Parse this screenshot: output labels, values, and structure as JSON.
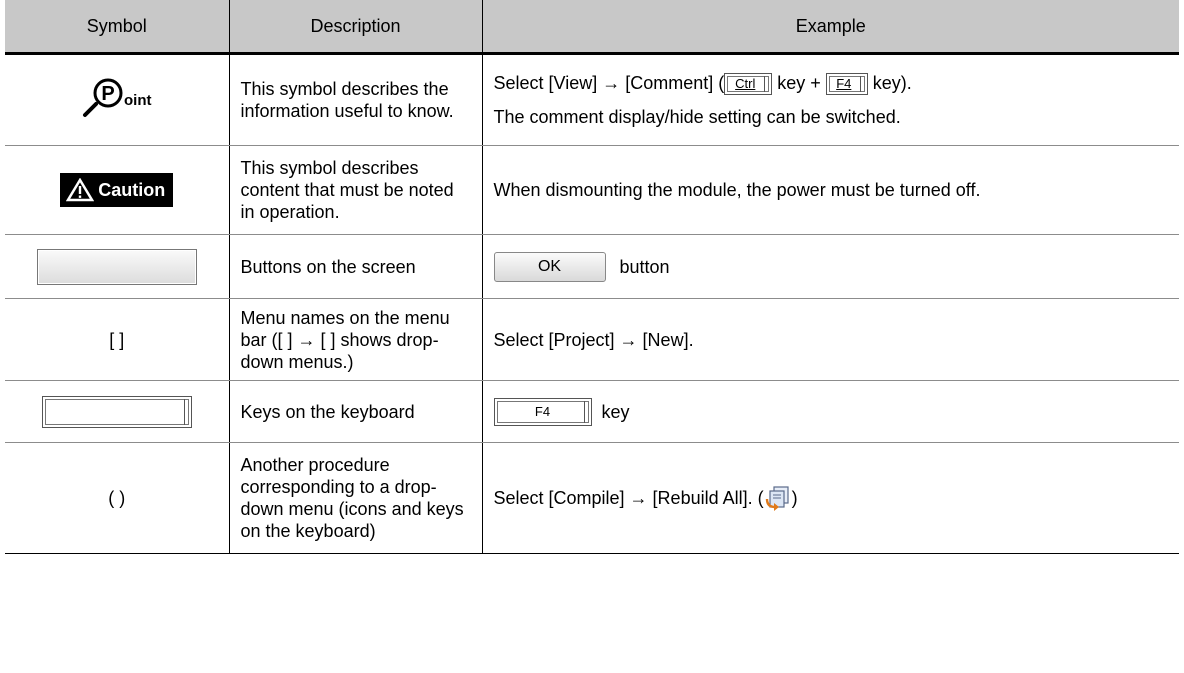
{
  "header": {
    "symbol": "Symbol",
    "description": "Description",
    "example": "Example"
  },
  "rows": [
    {
      "symbol_text": "oint",
      "symbol_icon": "point-icon",
      "description": "This symbol describes the information useful to know.",
      "example_parts": [
        "Select [View] → [Comment] (",
        "Ctrl",
        " key + ",
        "F4",
        " key)."
      ],
      "example_line2": "The comment display/hide setting can be switched."
    },
    {
      "symbol_text": "Caution",
      "symbol_icon": "caution-icon",
      "description": "This symbol describes content that must be noted in operation.",
      "example": "When dismounting the module, the power must be turned off."
    },
    {
      "symbol_icon": "button-symbol",
      "description": "Buttons on the screen",
      "example_button": "OK",
      "example_suffix": "button"
    },
    {
      "symbol_text": "[ ]",
      "description": "Menu names on the menu bar ([ ] → [ ] shows drop-down menus.)",
      "example": "Select [Project] → [New]."
    },
    {
      "symbol_icon": "key-symbol",
      "description": "Keys on the keyboard",
      "example_key": "F4",
      "example_suffix": "key"
    },
    {
      "symbol_text": "( )",
      "description": "Another procedure corresponding to a drop-down menu (icons and keys on the keyboard)",
      "example_prefix": "Select [Compile] → [Rebuild All]. (",
      "example_icon": "rebuild-all-icon",
      "example_suffix": ")"
    }
  ]
}
